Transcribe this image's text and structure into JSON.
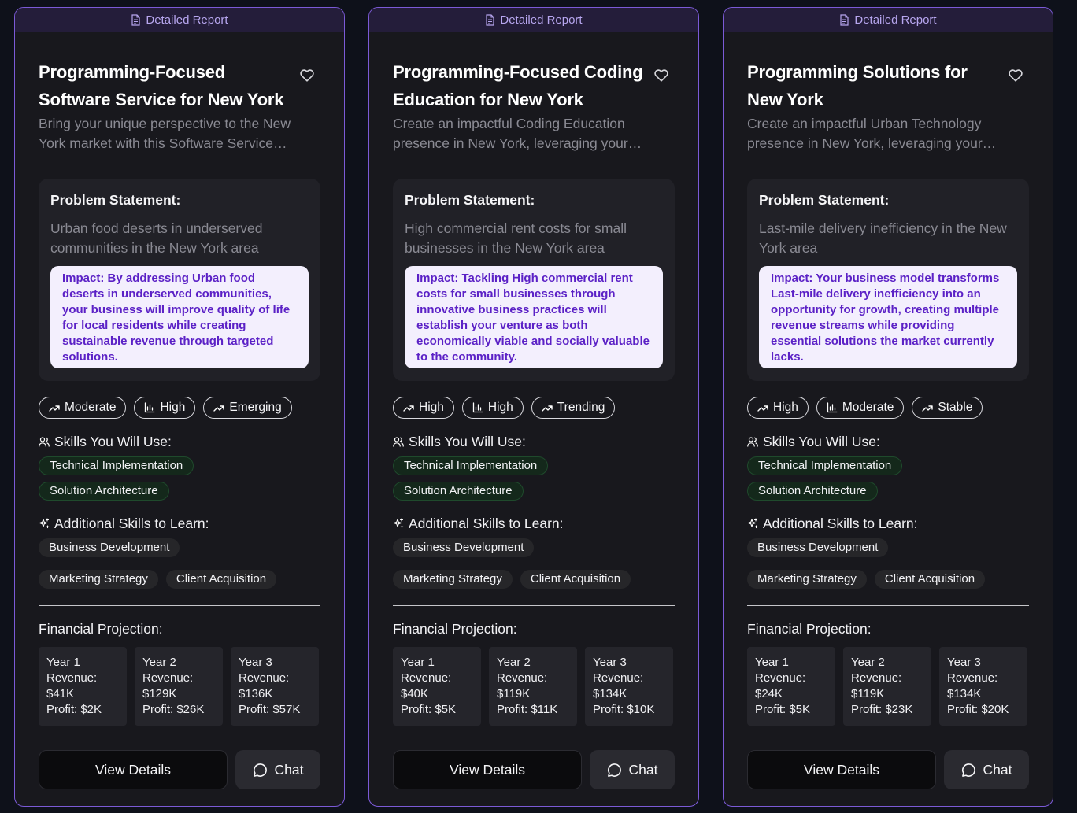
{
  "cards": [
    {
      "banner": "Detailed Report",
      "title": "Programming-Focused Software Service for New York",
      "description": "Bring your unique perspective to the New York market with this Software Service offering tailored to local needs and opportunities.",
      "problem_label": "Problem Statement:",
      "problem": "Urban food deserts in underserved communities in the New York area",
      "impact": "Impact: By addressing Urban food deserts in underserved communities, your business will improve quality of life for local residents while creating sustainable revenue through targeted solutions.",
      "metrics": [
        {
          "icon": "trending-up-icon",
          "label": "Moderate"
        },
        {
          "icon": "bar-chart-icon",
          "label": "High"
        },
        {
          "icon": "trending-up-icon",
          "label": "Emerging"
        }
      ],
      "skills_heading": "Skills You Will Use:",
      "skills": [
        "Technical Implementation",
        "Solution Architecture"
      ],
      "learn_heading": "Additional Skills to Learn:",
      "learn": [
        "Business Development",
        "Marketing Strategy",
        "Client Acquisition"
      ],
      "financial_heading": "Financial Projection:",
      "years": [
        {
          "year": "Year 1",
          "revenue_label": "Revenue:",
          "revenue": "$41K",
          "profit": "Profit: $2K"
        },
        {
          "year": "Year 2",
          "revenue_label": "Revenue:",
          "revenue": "$129K",
          "profit": "Profit: $26K"
        },
        {
          "year": "Year 3",
          "revenue_label": "Revenue:",
          "revenue": "$136K",
          "profit": "Profit: $57K"
        }
      ],
      "details_label": "View Details",
      "chat_label": "Chat"
    },
    {
      "banner": "Detailed Report",
      "title": "Programming-Focused Coding Education for New York",
      "description": "Create an impactful Coding Education presence in New York, leveraging your programming expertise to serve local learners.",
      "problem_label": "Problem Statement:",
      "problem": "High commercial rent costs for small businesses in the New York area",
      "impact": "Impact: Tackling High commercial rent costs for small businesses through innovative business practices will establish your venture as both economically viable and socially valuable to the community.",
      "metrics": [
        {
          "icon": "trending-up-icon",
          "label": "High"
        },
        {
          "icon": "bar-chart-icon",
          "label": "High"
        },
        {
          "icon": "trending-up-icon",
          "label": "Trending"
        }
      ],
      "skills_heading": "Skills You Will Use:",
      "skills": [
        "Technical Implementation",
        "Solution Architecture"
      ],
      "learn_heading": "Additional Skills to Learn:",
      "learn": [
        "Business Development",
        "Marketing Strategy",
        "Client Acquisition"
      ],
      "financial_heading": "Financial Projection:",
      "years": [
        {
          "year": "Year 1",
          "revenue_label": "Revenue:",
          "revenue": "$40K",
          "profit": "Profit: $5K"
        },
        {
          "year": "Year 2",
          "revenue_label": "Revenue:",
          "revenue": "$119K",
          "profit": "Profit: $11K"
        },
        {
          "year": "Year 3",
          "revenue_label": "Revenue:",
          "revenue": "$134K",
          "profit": "Profit: $10K"
        }
      ],
      "details_label": "View Details",
      "chat_label": "Chat"
    },
    {
      "banner": "Detailed Report",
      "title": "Programming Solutions for New York",
      "description": "Create an impactful Urban Technology presence in New York, leveraging your programming expertise to solve local challenges.",
      "problem_label": "Problem Statement:",
      "problem": "Last-mile delivery inefficiency in the New York area",
      "impact": "Impact: Your business model transforms Last-mile delivery inefficiency into an opportunity for growth, creating multiple revenue streams while providing essential solutions the market currently lacks.",
      "metrics": [
        {
          "icon": "trending-up-icon",
          "label": "High"
        },
        {
          "icon": "bar-chart-icon",
          "label": "Moderate"
        },
        {
          "icon": "trending-up-icon",
          "label": "Stable"
        }
      ],
      "skills_heading": "Skills You Will Use:",
      "skills": [
        "Technical Implementation",
        "Solution Architecture"
      ],
      "learn_heading": "Additional Skills to Learn:",
      "learn": [
        "Business Development",
        "Marketing Strategy",
        "Client Acquisition"
      ],
      "financial_heading": "Financial Projection:",
      "years": [
        {
          "year": "Year 1",
          "revenue_label": "Revenue:",
          "revenue": "$24K",
          "profit": "Profit: $5K"
        },
        {
          "year": "Year 2",
          "revenue_label": "Revenue:",
          "revenue": "$119K",
          "profit": "Profit: $23K"
        },
        {
          "year": "Year 3",
          "revenue_label": "Revenue:",
          "revenue": "$134K",
          "profit": "Profit: $20K"
        }
      ],
      "details_label": "View Details",
      "chat_label": "Chat"
    }
  ]
}
